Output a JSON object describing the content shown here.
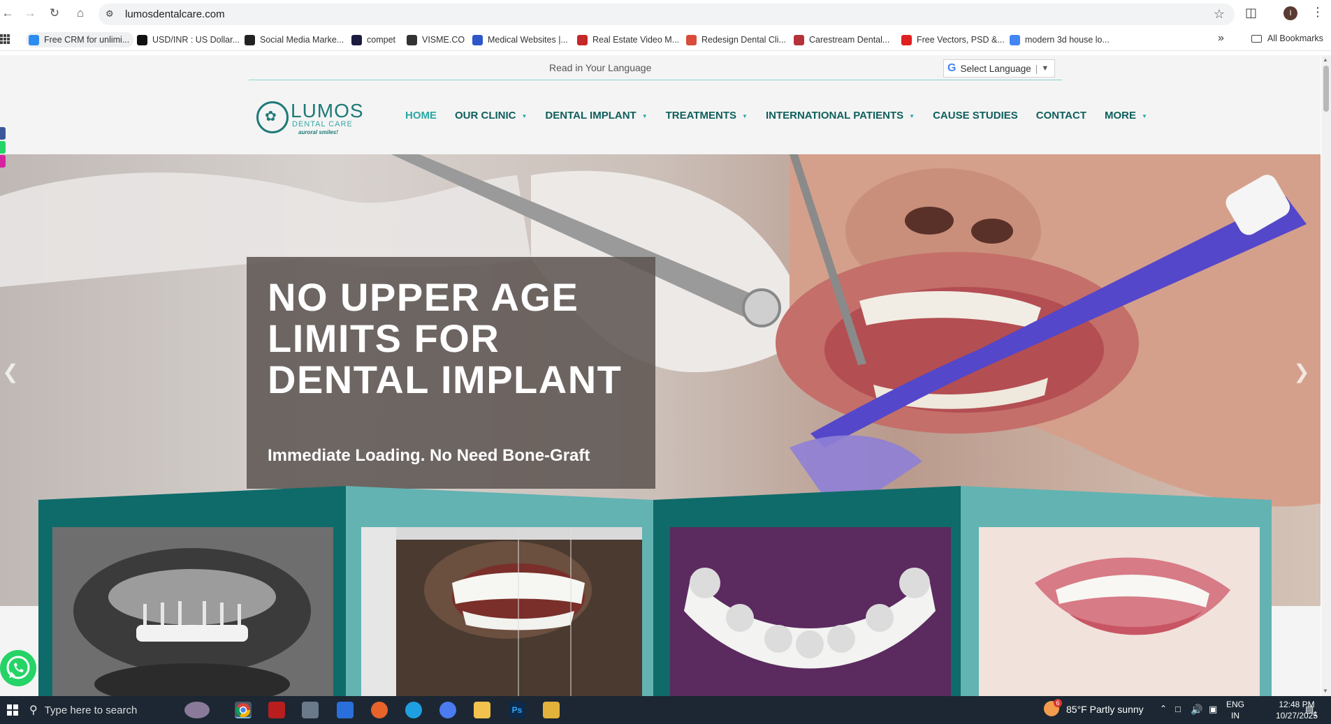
{
  "browser": {
    "url": "lumosdentalcare.com",
    "bookmarks": [
      {
        "label": "Free CRM for unlimi...",
        "icon": "crm-icon",
        "color": "#2d8cf0"
      },
      {
        "label": "USD/INR : US Dollar...",
        "icon": "xe-icon",
        "color": "#111111"
      },
      {
        "label": "Social Media Marke...",
        "icon": "db-icon",
        "color": "#222222"
      },
      {
        "label": "compet",
        "icon": "compet-icon",
        "color": "#1b1b40"
      },
      {
        "label": "VISME.CO",
        "icon": "visme-icon",
        "color": "#333333"
      },
      {
        "label": "Medical Websites |...",
        "icon": "medical-icon",
        "color": "#2f56c9"
      },
      {
        "label": "Real Estate Video M...",
        "icon": "realestate-icon",
        "color": "#c42828"
      },
      {
        "label": "Redesign Dental Cli...",
        "icon": "redesign-icon",
        "color": "#d94b3a"
      },
      {
        "label": "Carestream Dental...",
        "icon": "carestream-icon",
        "color": "#b5323a"
      },
      {
        "label": "Free Vectors, PSD &...",
        "icon": "freepik-icon",
        "color": "#e02020"
      },
      {
        "label": "modern 3d house lo...",
        "icon": "google-icon",
        "color": "#4285f4"
      }
    ],
    "all_bookmarks": "All Bookmarks",
    "profile_initial": "I"
  },
  "site": {
    "read_language": "Read in Your Language",
    "select_language": "Select Language",
    "logo": {
      "name": "LUMOS",
      "sub": "DENTAL CARE",
      "tagline": "auroral smiles!"
    },
    "nav": [
      {
        "label": "HOME",
        "active": true,
        "dropdown": false
      },
      {
        "label": "OUR CLINIC",
        "active": false,
        "dropdown": true
      },
      {
        "label": "DENTAL IMPLANT",
        "active": false,
        "dropdown": true
      },
      {
        "label": "TREATMENTS",
        "active": false,
        "dropdown": true
      },
      {
        "label": "INTERNATIONAL PATIENTS",
        "active": false,
        "dropdown": true
      },
      {
        "label": "CAUSE STUDIES",
        "active": false,
        "dropdown": false
      },
      {
        "label": "CONTACT",
        "active": false,
        "dropdown": false
      },
      {
        "label": "MORE",
        "active": false,
        "dropdown": true
      }
    ],
    "hero": {
      "title": "NO UPPER AGE LIMITS FOR DENTAL IMPLANT",
      "subtitle": "Immediate Loading. No Need Bone-Graft"
    },
    "colors": {
      "brand_dark": "#0e5f5c",
      "brand_light": "#29a6a3",
      "panel_dark": "#0f6b69",
      "panel_light": "#62b3b2"
    }
  },
  "taskbar": {
    "search_placeholder": "Type here to search",
    "weather": "85°F  Partly sunny",
    "weather_badge": "6",
    "lang": "ENG",
    "region": "IN",
    "time": "12:48 PM",
    "date": "10/27/2025",
    "notification_count": "1"
  }
}
